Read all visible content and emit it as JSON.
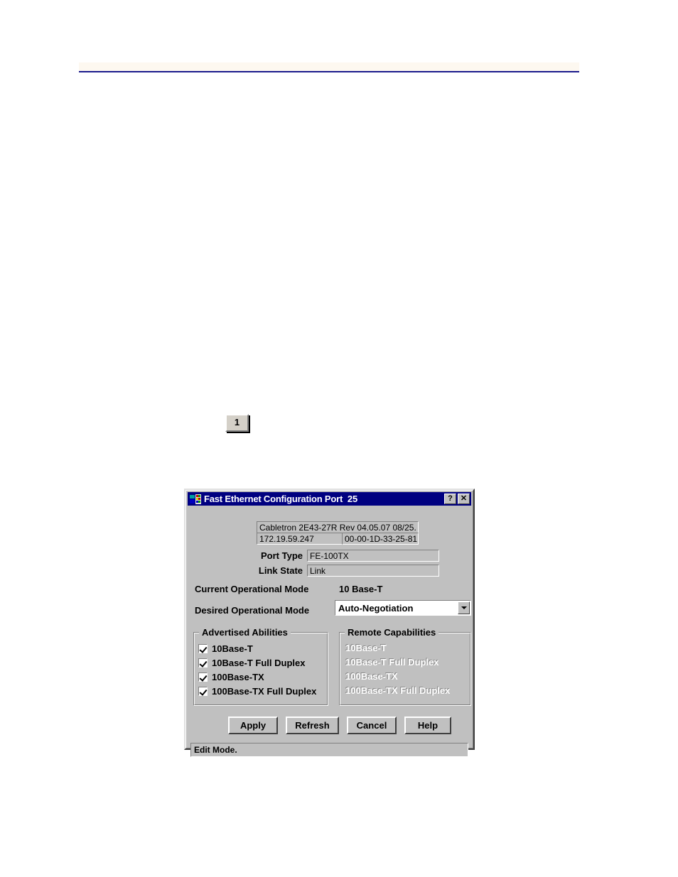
{
  "page": {
    "header_band_color": "#fdf8f0",
    "header_rule_color": "#1a1a8c",
    "marker_label": "1"
  },
  "dialog": {
    "title": "Fast Ethernet Configuration Port  25",
    "titlebar_color": "#000080",
    "face_color": "#c0c0c0",
    "help_button_label": "?",
    "close_button_label": "✕",
    "device_info": {
      "description": "Cabletron 2E43-27R Rev 04.05.07  08/25.",
      "ip_address": "172.19.59.247",
      "mac_address": "00-00-1D-33-25-81"
    },
    "fields": {
      "port_type_label": "Port Type",
      "port_type_value": "FE-100TX",
      "link_state_label": "Link State",
      "link_state_value": "Link"
    },
    "current_mode": {
      "label": "Current Operational Mode",
      "value": "10 Base-T"
    },
    "desired_mode": {
      "label": "Desired Operational Mode",
      "value": "Auto-Negotiation",
      "options": [
        "Auto-Negotiation"
      ]
    },
    "advertised_abilities": {
      "title": "Advertised Abilities",
      "items": [
        {
          "label": "10Base-T",
          "checked": true
        },
        {
          "label": "10Base-T Full Duplex",
          "checked": true
        },
        {
          "label": "100Base-TX",
          "checked": true
        },
        {
          "label": "100Base-TX Full Duplex",
          "checked": true
        }
      ]
    },
    "remote_capabilities": {
      "title": "Remote Capabilities",
      "items": [
        {
          "label": "10Base-T",
          "disabled": true
        },
        {
          "label": "10Base-T Full Duplex",
          "disabled": true
        },
        {
          "label": "100Base-TX",
          "disabled": true
        },
        {
          "label": "100Base-TX Full Duplex",
          "disabled": true
        }
      ]
    },
    "buttons": {
      "apply": "Apply",
      "refresh": "Refresh",
      "cancel": "Cancel",
      "help": "Help"
    },
    "status": "Edit Mode."
  }
}
